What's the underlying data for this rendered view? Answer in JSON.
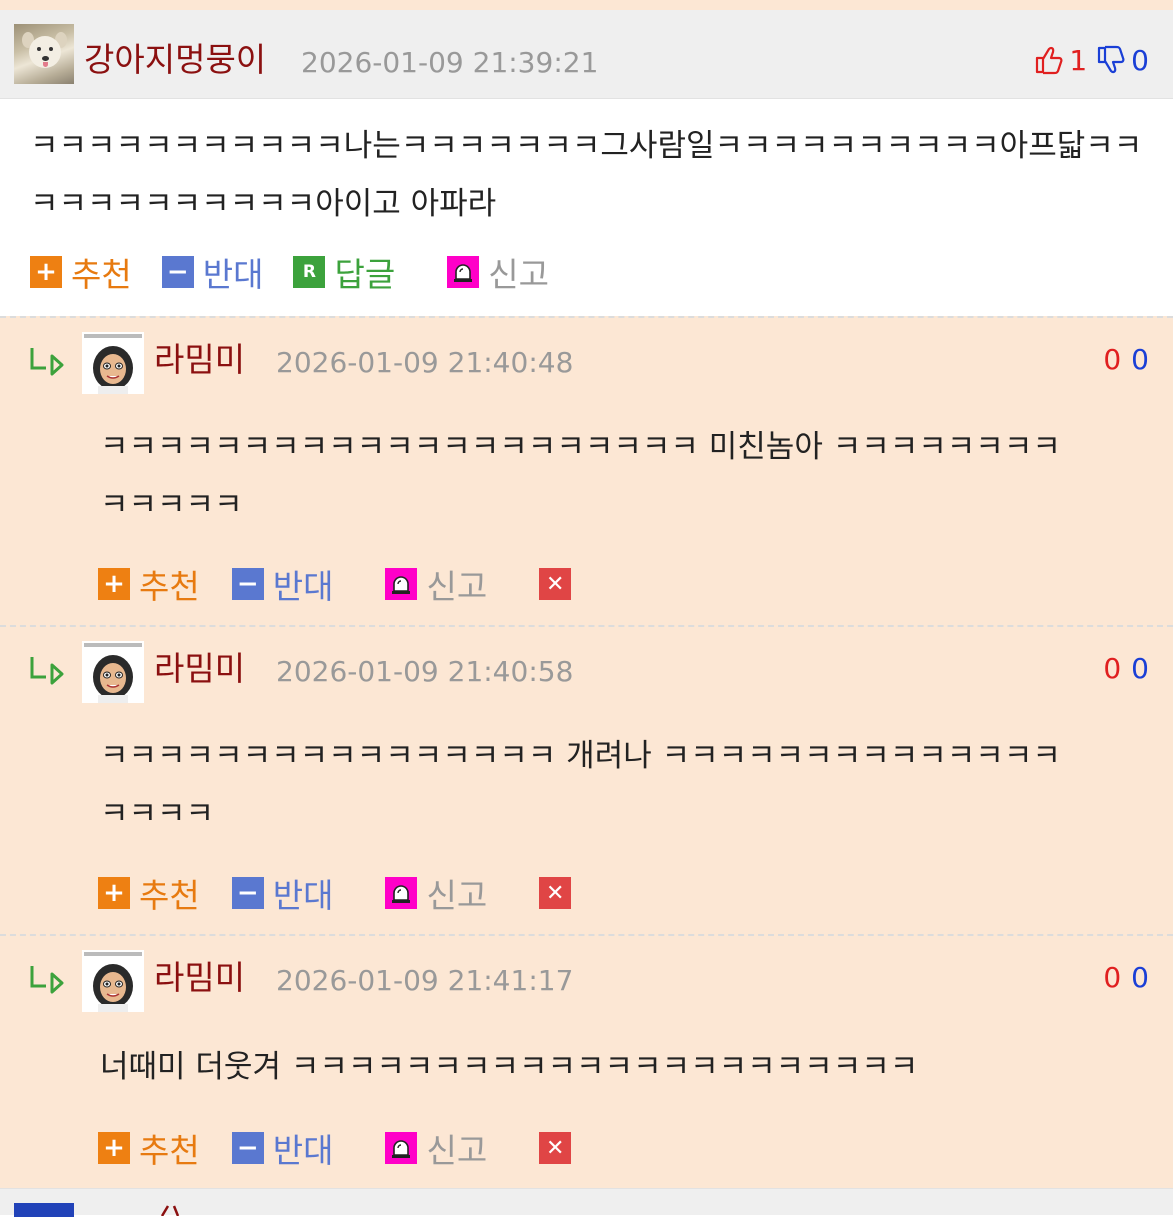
{
  "main_comment": {
    "nickname": "강아지멍뭉이",
    "datetime": "2026-01-09 21:39:21",
    "upvotes": "1",
    "downvotes": "0",
    "text": "ㅋㅋㅋㅋㅋㅋㅋㅋㅋㅋㅋ나는ㅋㅋㅋㅋㅋㅋㅋ그사람일ㅋㅋㅋㅋㅋㅋㅋㅋㅋㅋ아프닯ㅋㅋㅋㅋㅋㅋㅋㅋㅋㅋㅋㅋ아이고 아파라",
    "actions": {
      "recommend": "추천",
      "oppose": "반대",
      "reply": "답글",
      "report": "신고",
      "reply_icon": "R"
    }
  },
  "replies": [
    {
      "nickname": "라밈미",
      "datetime": "2026-01-09 21:40:48",
      "upvotes": "0",
      "downvotes": "0",
      "text_line1": "ㅋㅋㅋㅋㅋㅋㅋㅋㅋㅋㅋㅋㅋㅋㅋㅋㅋㅋㅋㅋㅋ 미친놈아 ㅋㅋㅋㅋㅋㅋㅋㅋ",
      "text_line2": "ㅋㅋㅋㅋㅋ"
    },
    {
      "nickname": "라밈미",
      "datetime": "2026-01-09 21:40:58",
      "upvotes": "0",
      "downvotes": "0",
      "text_line1": "ㅋㅋㅋㅋㅋㅋㅋㅋㅋㅋㅋㅋㅋㅋㅋㅋ 개려나 ㅋㅋㅋㅋㅋㅋㅋㅋㅋㅋㅋㅋㅋㅋ",
      "text_line2": "ㅋㅋㅋㅋ"
    },
    {
      "nickname": "라밈미",
      "datetime": "2026-01-09 21:41:17",
      "upvotes": "0",
      "downvotes": "0",
      "text_line1": "너때미 더웃겨 ㅋㅋㅋㅋㅋㅋㅋㅋㅋㅋㅋㅋㅋㅋㅋㅋㅋㅋㅋㅋㅋㅋ",
      "text_line2": ""
    }
  ],
  "reply_actions": {
    "recommend": "추천",
    "oppose": "반대",
    "report": "신고"
  },
  "icons": {
    "thumbs_up": "thumbs-up-icon",
    "thumbs_down": "thumbs-down-icon",
    "reply_arrow": "reply-arrow-icon",
    "plus": "plus-icon",
    "minus": "minus-icon",
    "siren": "siren-icon",
    "delete": "close-icon"
  },
  "colors": {
    "nickname": "#8b1010",
    "reply_bg": "#fce7d4",
    "header_bg": "#efefef",
    "recommend": "#e77a10",
    "oppose": "#5a78d0",
    "reply": "#3ca23c",
    "report_icon": "#ff00c8",
    "delete": "#e04545",
    "upvote": "#e02020",
    "downvote": "#1a3fd6"
  }
}
